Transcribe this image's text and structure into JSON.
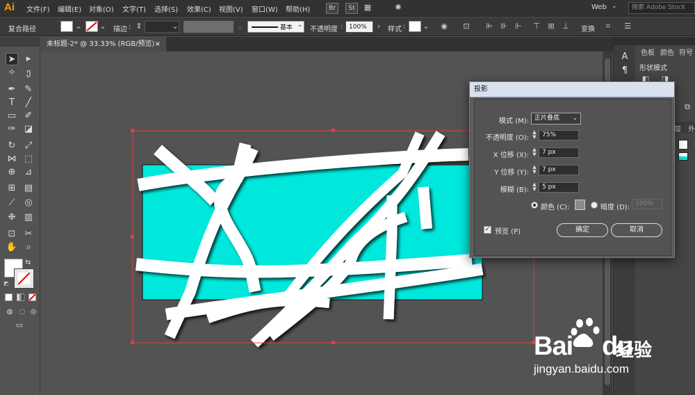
{
  "app": {
    "logo": "Ai"
  },
  "menu": {
    "items": [
      "文件(F)",
      "编辑(E)",
      "对象(O)",
      "文字(T)",
      "选择(S)",
      "效果(C)",
      "视图(V)",
      "窗口(W)",
      "帮助(H)"
    ],
    "bridge_btn": "Br",
    "stock_btn": "St",
    "workspace": "Web",
    "search_placeholder": "搜索 Adobe Stock"
  },
  "control_bar": {
    "object_type": "复合路径",
    "stroke_label": "描边",
    "stroke_profile": "基本",
    "opacity_label": "不透明度",
    "opacity_value": "100%",
    "style_label": "样式",
    "transform_label": "变换"
  },
  "document": {
    "tab_title": "未标题-2* @ 33.33% (RGB/预览)",
    "tab_close": "×"
  },
  "right_panel": {
    "tabs": [
      "色板",
      "颜色",
      "符号"
    ],
    "section": "形状模式",
    "collapsed_tabs": [
      "层",
      "外"
    ]
  },
  "dialog": {
    "title": "投影",
    "mode_label": "模式 (M):",
    "mode_value": "正片叠底",
    "opacity_label": "不透明度 (O):",
    "opacity_value": "75%",
    "x_label": "X 位移 (X):",
    "x_value": "7 px",
    "y_label": "Y 位移 (Y):",
    "y_value": "7 px",
    "blur_label": "模糊 (B):",
    "blur_value": "5 px",
    "color_label": "颜色 (C):",
    "darkness_label": "暗度 (D):",
    "darkness_value": "100%",
    "preview_label": "预览 (P)",
    "ok_label": "确定",
    "cancel_label": "取消",
    "color_selected": true,
    "preview_checked": true
  },
  "artwork": {
    "fill_color": "#00e8dc",
    "stripe_color": "#ffffff",
    "selection_color": "#e04040"
  },
  "watermark": {
    "brand_latin_1": "Bai",
    "brand_latin_2": "du",
    "brand_cn": "经验",
    "url": "jingyan.baidu.com"
  }
}
